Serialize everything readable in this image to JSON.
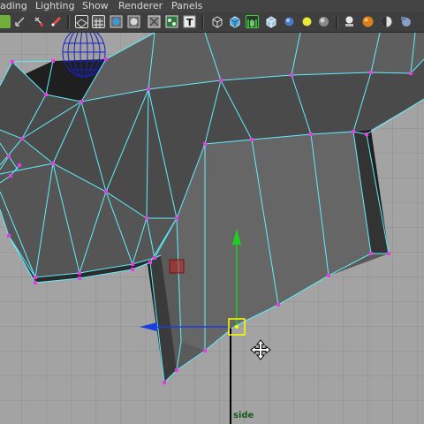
{
  "menubar": {
    "items": [
      "ading",
      "Lighting",
      "Show",
      "Renderer",
      "Panels"
    ]
  },
  "toolbar": {
    "icons": [
      "dolly-icon",
      "uv-tool-icon",
      "magnet-snap-icon",
      "paint-icon",
      "xray-icon",
      "grid-toggle-icon",
      "smooth-shade-icon",
      "flat-shade-icon",
      "bounding-box-icon",
      "texture-icon",
      "text-icon",
      "wireframe-cube-icon",
      "shaded-cube-icon",
      "isolate-select-icon",
      "xray-cube-icon",
      "light-bulb-icon",
      "checker-icon",
      "sphere-shade-icon",
      "hud-head-icon",
      "orange-sphere-icon",
      "half-sphere-icon",
      "bottle-icon"
    ]
  },
  "viewport": {
    "camera_label": "side",
    "background_color": "#a3a3a3",
    "grid_color": "#8f8f8f",
    "mesh_edge_color": "#5ff0ff",
    "vertex_color": "#e040e0",
    "axis_y_color": "#1fcf1f",
    "axis_z_color": "#1a3fe0",
    "pivot_color": "#ffff00",
    "selected_marker_color": "#c02020"
  }
}
